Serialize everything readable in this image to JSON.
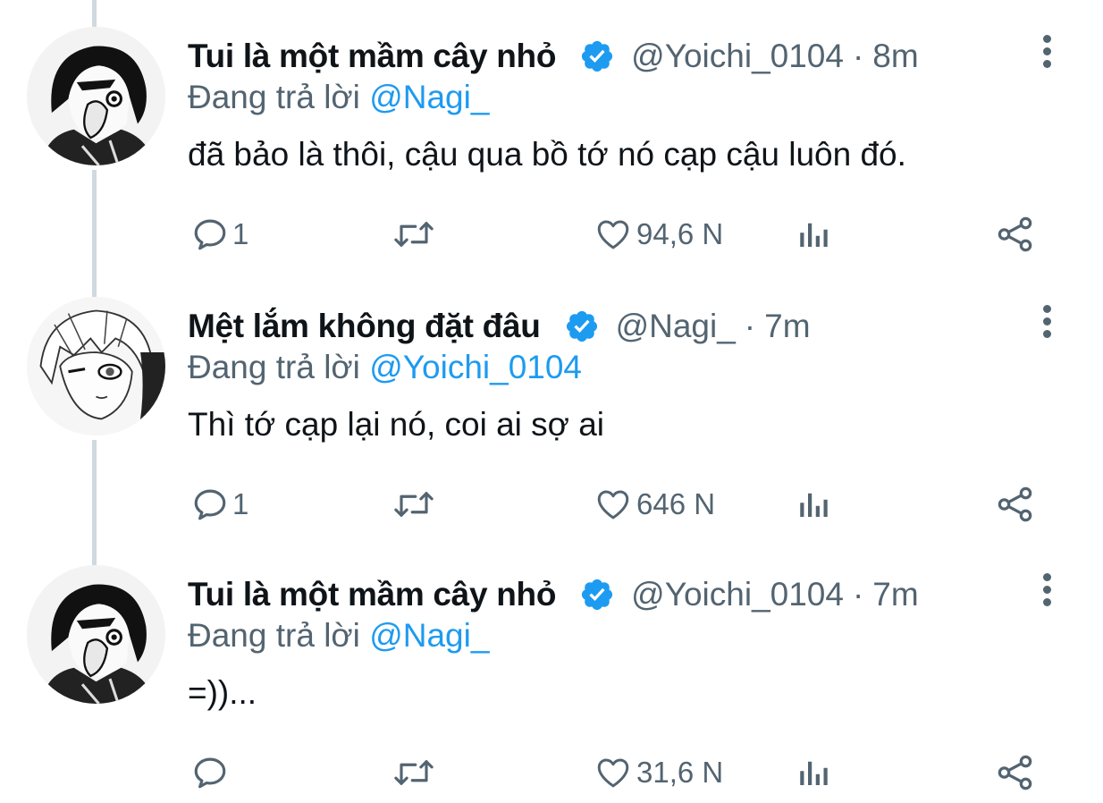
{
  "replying_prefix": "Đang trả lời",
  "tweets": [
    {
      "display_name": "Tui là một mầm cây nhỏ",
      "handle": "@Yoichi_0104",
      "separator": "·",
      "time": "8m",
      "replying_to": "@Nagi_",
      "text": "đã bảo là thôi, cậu qua bồ tớ nó cạp cậu luôn đó.",
      "reply_count": "1",
      "like_count": "94,6 N",
      "avatar": "dark-hair-manga-boy-avatar"
    },
    {
      "display_name": "Mệt lắm không đặt đâu",
      "handle": "@Nagi_",
      "separator": "·",
      "time": "7m",
      "replying_to": "@Yoichi_0104",
      "text": "Thì tớ cạp lại nó, coi ai sợ ai",
      "reply_count": "1",
      "like_count": "646 N",
      "avatar": "white-hair-manga-boy-avatar"
    },
    {
      "display_name": "Tui là một mầm cây nhỏ",
      "handle": "@Yoichi_0104",
      "separator": "·",
      "time": "7m",
      "replying_to": "@Nagi_",
      "text": "=))...",
      "reply_count": "",
      "like_count": "31,6 N",
      "avatar": "dark-hair-manga-boy-avatar"
    }
  ],
  "icons": {
    "verified": "verified-badge-icon",
    "reply": "reply-bubble-icon",
    "retweet": "retweet-icon",
    "like": "heart-icon",
    "views": "analytics-icon",
    "share": "share-icon",
    "more": "more-vertical-icon"
  },
  "colors": {
    "accent": "#1d9bf0",
    "muted": "#536471",
    "text": "#0f1419",
    "thread_line": "#cfd9de"
  }
}
